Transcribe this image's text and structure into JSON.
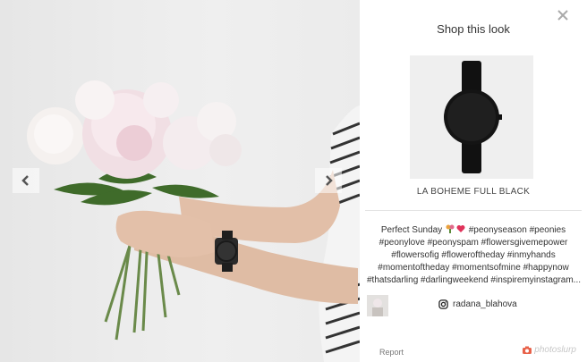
{
  "modal": {
    "title": "Shop this look",
    "product_name": "LA BOHEME FULL BLACK",
    "caption_lines": [
      "Perfect Sunday",
      "#peonyseason #peonies",
      "#peonylove #peonyspam #flowersgivemepower",
      "#flowersofig #floweroftheday #inmyhands",
      "#momentoftheday #momentsofmine #happynow",
      "#thatsdarling #darlingweekend #inspiremyinstagram..."
    ],
    "username": "radana_blahova",
    "report_label": "Report",
    "brand_label": "photoslurp"
  },
  "icons": {
    "close": "close-icon",
    "prev": "chevron-left-icon",
    "next": "chevron-right-icon",
    "instagram": "instagram-icon",
    "camera": "camera-icon"
  },
  "colors": {
    "brand": "#e8624a",
    "text": "#333333",
    "muted": "#777777"
  }
}
